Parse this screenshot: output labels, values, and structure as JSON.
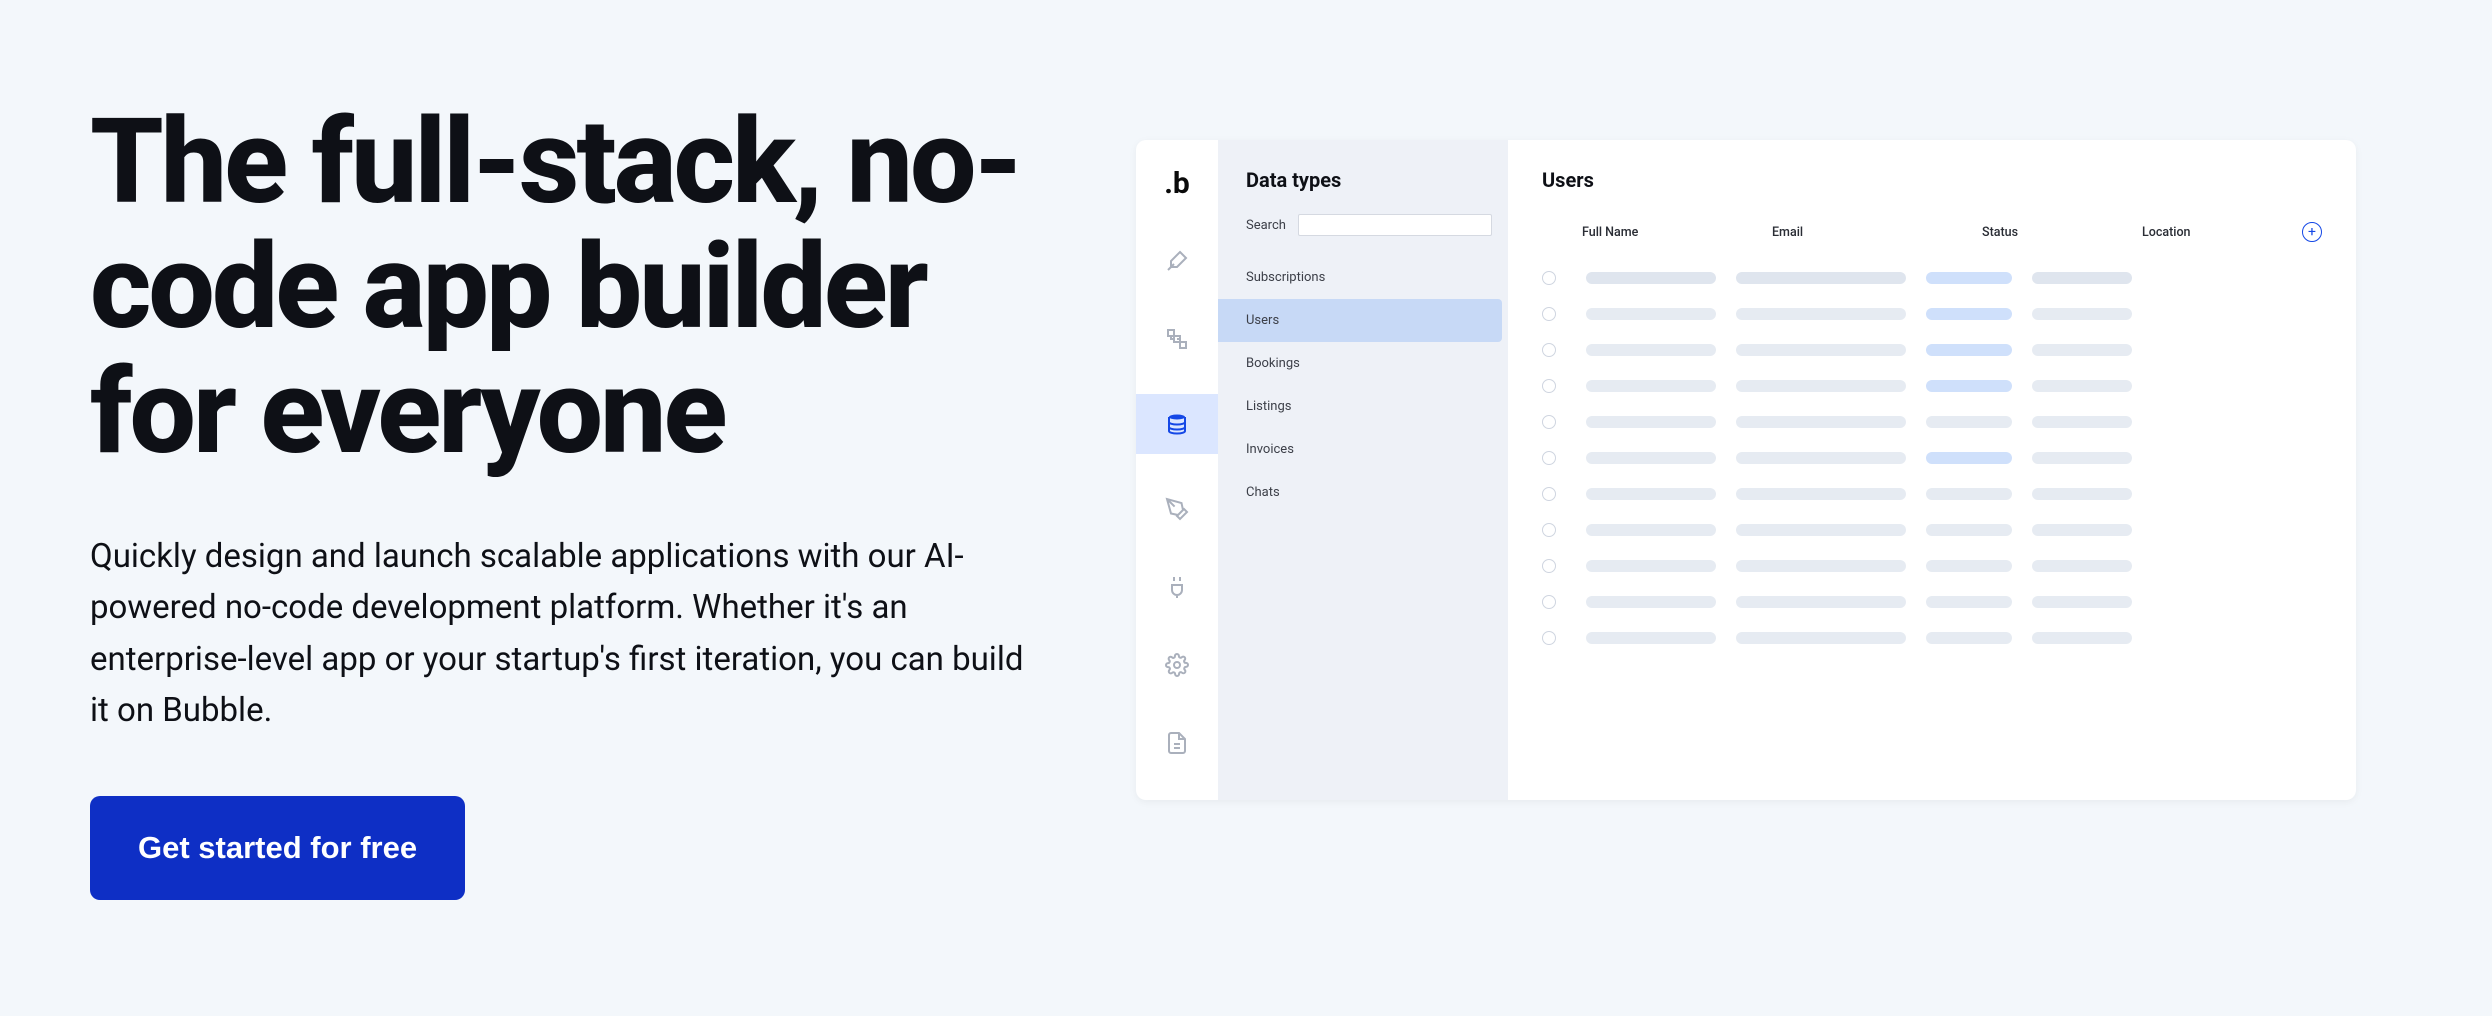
{
  "hero": {
    "title": "The full-stack, no-code app builder for everyone",
    "body": "Quickly design and launch scalable applications with our AI-powered no-code development platform. Whether it's an enterprise-level app or your startup's first iteration, you can build it on Bubble.",
    "cta": "Get started for free"
  },
  "app": {
    "sidebar_title": "Data types",
    "search_label": "Search",
    "data_types": [
      "Subscriptions",
      "Users",
      "Bookings",
      "Listings",
      "Invoices",
      "Chats"
    ],
    "selected_type": "Users",
    "main_title": "Users",
    "columns": [
      "Full Name",
      "Email",
      "Status",
      "Location"
    ]
  }
}
